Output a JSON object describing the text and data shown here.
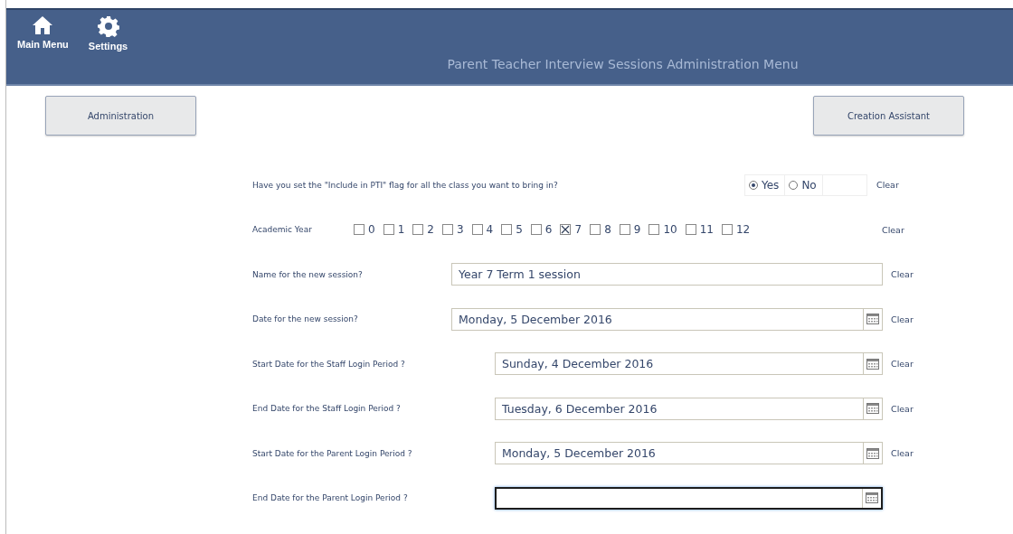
{
  "toolbar": [
    {
      "kind": "home",
      "label": "Main Menu"
    },
    {
      "kind": "settings",
      "label": "Settings"
    }
  ],
  "header_title": "Parent Teacher Interview Sessions Administration Menu",
  "buttons": [
    "Administration",
    "Creation Assistant"
  ],
  "flag_question": {
    "label": "Have you set the \"Include in PTI\" flag for all the class you want to bring in?",
    "options": [
      {
        "label": "Yes",
        "selected": true
      },
      {
        "label": "No",
        "selected": false
      }
    ],
    "clear": "Clear"
  },
  "academic_year": {
    "label": "Academic Year",
    "options": [
      {
        "label": "0",
        "checked": false
      },
      {
        "label": "1",
        "checked": false
      },
      {
        "label": "2",
        "checked": false
      },
      {
        "label": "3",
        "checked": false
      },
      {
        "label": "4",
        "checked": false
      },
      {
        "label": "5",
        "checked": false
      },
      {
        "label": "6",
        "checked": false
      },
      {
        "label": "7",
        "checked": true
      },
      {
        "label": "8",
        "checked": false
      },
      {
        "label": "9",
        "checked": false
      },
      {
        "label": "10",
        "checked": false
      },
      {
        "label": "11",
        "checked": false
      },
      {
        "label": "12",
        "checked": false
      }
    ],
    "clear": "Clear"
  },
  "fields": [
    {
      "kind": "text",
      "label": "Name for the new session?",
      "value": "Year 7 Term 1 session",
      "focused": false,
      "clear": "Clear"
    },
    {
      "kind": "date",
      "label": "Date for the new session?",
      "value": "Monday, 5 December 2016",
      "focused": false,
      "clear": "Clear"
    },
    {
      "kind": "period_date",
      "label": "Start Date for the Staff Login Period ?",
      "value": "Sunday, 4 December 2016",
      "focused": false,
      "clear": "Clear"
    },
    {
      "kind": "period_date",
      "label": "End Date for the Staff Login Period ?",
      "value": "Tuesday, 6 December 2016",
      "focused": false,
      "clear": "Clear"
    },
    {
      "kind": "period_date",
      "label": "Start Date for the Parent Login Period ?",
      "value": "Monday, 5 December 2016",
      "focused": false,
      "clear": "Clear"
    },
    {
      "kind": "period_date",
      "label": "End Date for the Parent Login Period ?",
      "focused": true
    }
  ]
}
